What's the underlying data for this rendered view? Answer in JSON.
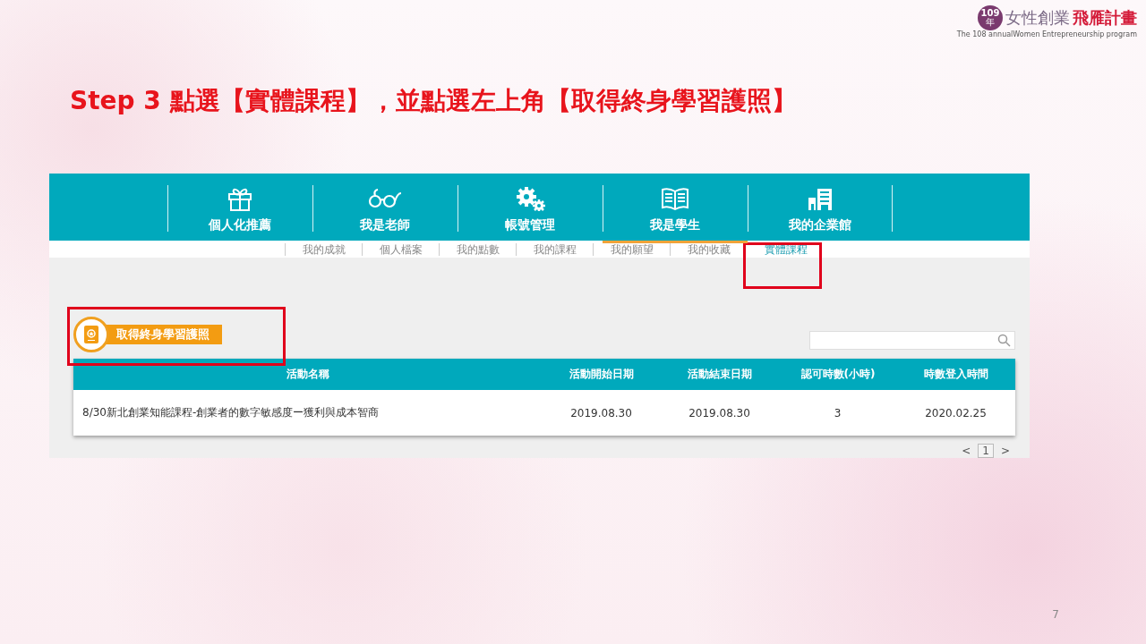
{
  "logo": {
    "badge": "109",
    "badge_suffix": "年",
    "title_main": "女性創業",
    "title_accent": "飛雁計畫",
    "subtitle": "The 108 annualWomen Entrepreneurship program"
  },
  "slide_title": "Step 3 點選【實體課程】，並點選左上角【取得終身學習護照】",
  "nav": [
    {
      "label": "個人化推薦",
      "selected": false
    },
    {
      "label": "我是老師",
      "selected": false
    },
    {
      "label": "帳號管理",
      "selected": false
    },
    {
      "label": "我是學生",
      "selected": true
    },
    {
      "label": "我的企業館",
      "selected": false
    }
  ],
  "subnav": [
    {
      "label": "我的成就",
      "selected": false
    },
    {
      "label": "個人檔案",
      "selected": false
    },
    {
      "label": "我的點數",
      "selected": false
    },
    {
      "label": "我的課程",
      "selected": false
    },
    {
      "label": "我的願望",
      "selected": false
    },
    {
      "label": "我的收藏",
      "selected": false
    },
    {
      "label": "實體課程",
      "selected": true
    }
  ],
  "passport_button": {
    "label": "取得終身學習護照"
  },
  "table": {
    "columns": [
      "活動名稱",
      "活動開始日期",
      "活動結束日期",
      "認可時數(小時)",
      "時數登入時間"
    ],
    "rows": [
      [
        "8/30新北創業知能課程-創業者的數字敏感度ー獲利與成本智商",
        "2019.08.30",
        "2019.08.30",
        "3",
        "2020.02.25"
      ]
    ]
  },
  "pagination": {
    "prev": "<",
    "pages": [
      {
        "label": "1",
        "selected": true
      }
    ],
    "next": ">"
  },
  "page_number": "7"
}
